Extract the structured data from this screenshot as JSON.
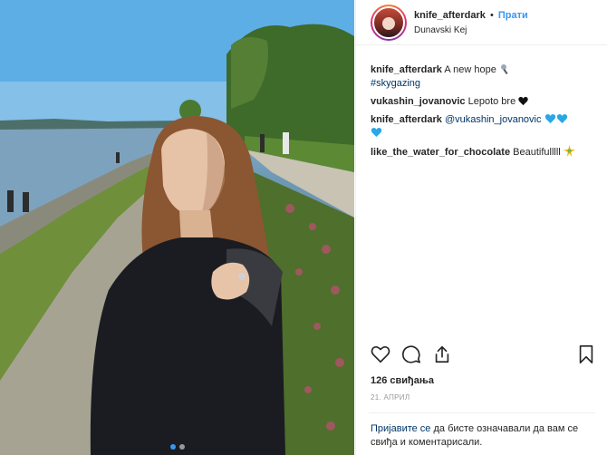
{
  "post": {
    "photo_alt_icon": "post-photo",
    "carousel": {
      "count": 2,
      "active": 1
    }
  },
  "header": {
    "username": "knife_afterdark",
    "separator": "•",
    "follow_label": "Прати",
    "location": "Dunavski Kej"
  },
  "comments": [
    {
      "user": "knife_afterdark",
      "text": " A new hope ",
      "emoji": "microphone"
    },
    {
      "user": "",
      "text": "",
      "hashtag": "#skygazing"
    },
    {
      "user": "vukashin_jovanovic",
      "text": " Lepoto bre ",
      "emoji": "black-heart"
    },
    {
      "user": "knife_afterdark",
      "mention": "@vukashin_jovanovic",
      "emoji": "blue-hearts"
    },
    {
      "user": "like_the_water_for_chocolate",
      "text": " Beautifulllll ",
      "emoji": "sparkle"
    }
  ],
  "actions": {
    "like_icon": "heart-icon",
    "comment_icon": "comment-icon",
    "share_icon": "share-icon",
    "save_icon": "bookmark-icon"
  },
  "likes_text": "126 свиђања",
  "date_text": "21. АПРИЛ",
  "login": {
    "link": "Пријавите се",
    "rest": " да бисте означавали да вам се свиђа и коментарисали."
  },
  "colors": {
    "link": "#3897f0",
    "hashtag": "#003569",
    "text": "#262626",
    "muted": "#999999"
  }
}
